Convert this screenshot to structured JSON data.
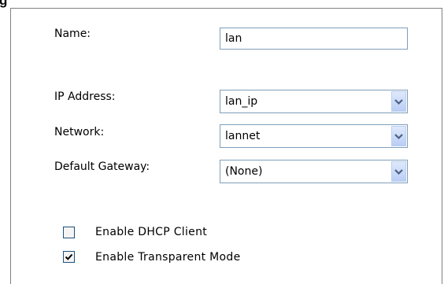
{
  "title_fragment": "g",
  "form": {
    "name_label": "Name:",
    "name_value": "lan",
    "ip_label": "IP Address:",
    "ip_value": "lan_ip",
    "network_label": "Network:",
    "network_value": "lannet",
    "gateway_label": "Default Gateway:",
    "gateway_value": "(None)",
    "dhcp_label": "Enable DHCP Client",
    "dhcp_checked": false,
    "transparent_label": "Enable Transparent Mode",
    "transparent_checked": true
  },
  "colors": {
    "input_border": "#7f9db9",
    "dropdown_button": "#c4d3f6",
    "arrow": "#4d6185",
    "check": "#21a121"
  },
  "icons": {
    "dropdown": "chevron-down-icon",
    "check": "checkmark-icon"
  }
}
